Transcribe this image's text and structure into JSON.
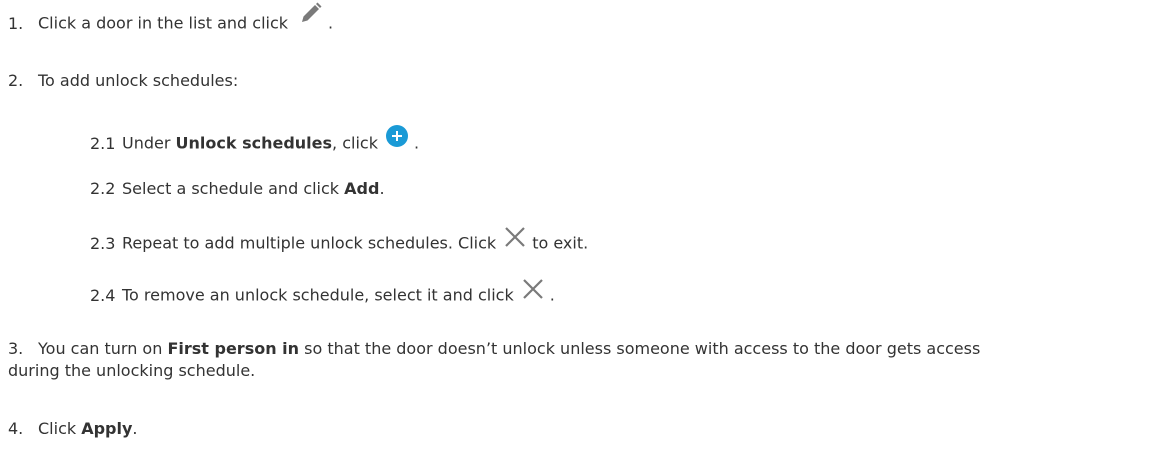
{
  "steps": [
    {
      "num": "1.",
      "text": "Click a door in the list and click",
      "after": "."
    },
    {
      "num": "2.",
      "text": "To add unlock schedules:"
    },
    {
      "num": "3.",
      "text_before": "You can turn on",
      "bold": "First person in",
      "text_after": "so that the door doesn’t unlock unless someone with access to the door gets access",
      "line2": "during the unlocking schedule."
    },
    {
      "num": "4.",
      "text_before": "Click",
      "bold": "Apply",
      "text_after": "."
    }
  ],
  "substeps": [
    {
      "num": "2.1",
      "text_before": "Under",
      "bold": "Unlock schedules",
      "text_after": ", click",
      "after": "."
    },
    {
      "num": "2.2",
      "text_before": "Select a schedule and click",
      "bold": "Add",
      "text_after": "."
    },
    {
      "num": "2.3",
      "text_before": "Repeat to add multiple unlock schedules. Click",
      "after": "to exit."
    },
    {
      "num": "2.4",
      "text_before": "To remove an unlock schedule, select it and click",
      "after": "."
    }
  ],
  "icons": {
    "pencil": "pencil-icon",
    "plus": "plus-circle-icon",
    "close": "close-icon",
    "plus_color": "#1a9ad6",
    "icon_gray": "#7a7a7a"
  }
}
